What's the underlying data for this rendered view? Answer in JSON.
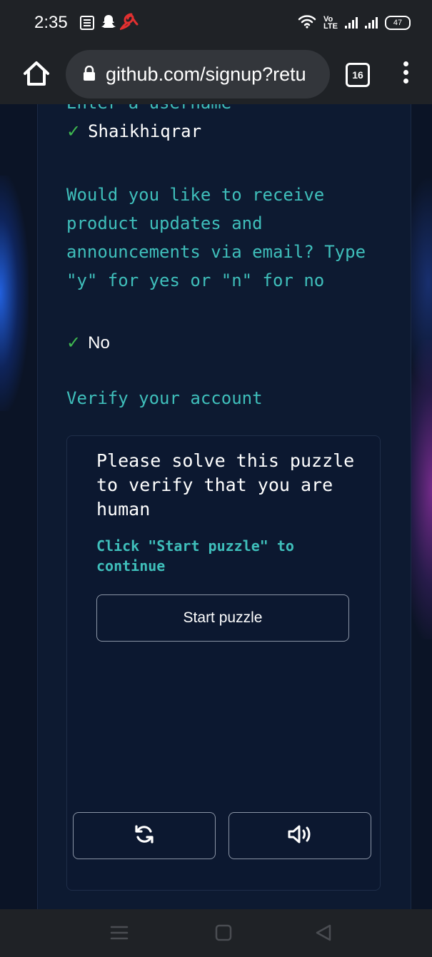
{
  "status_bar": {
    "time": "2:35",
    "volte_label": "Vo\nLTE",
    "battery": "47",
    "icons": [
      "notification-box-icon",
      "snapchat-icon",
      "airtel-icon",
      "wifi-icon",
      "signal-icon",
      "battery-icon"
    ]
  },
  "browser": {
    "url": "github.com/signup?retu",
    "tab_count": "16",
    "icons": [
      "home-icon",
      "lock-icon",
      "tabs-icon",
      "more-vert-icon"
    ]
  },
  "signup": {
    "username_label": "Enter a username",
    "username_value": "Shaikhiqrar",
    "email_question": "Would you like to receive product updates and announcements via email? Type \"y\" for yes or \"n\" for no",
    "email_answer": "No",
    "check_mark": "✓",
    "verify_title": "Verify your account"
  },
  "puzzle": {
    "text": "Please solve this puzzle to verify that you are human",
    "hint": "Click \"Start puzzle\" to continue",
    "start_label": "Start puzzle",
    "icons": [
      "reload-icon",
      "audio-icon"
    ]
  },
  "nav_bar": {
    "icons": [
      "recents-icon",
      "home-square-icon",
      "back-icon"
    ]
  },
  "colors": {
    "accent_cyan": "#3fbfbb",
    "check_green": "#3fb950",
    "background": "#0b1426"
  }
}
